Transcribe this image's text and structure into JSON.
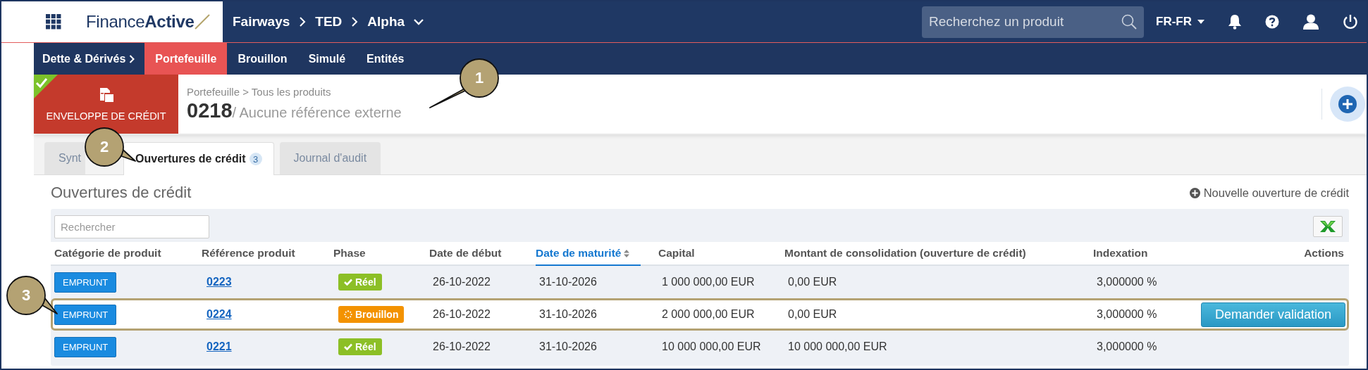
{
  "top_bar": {
    "logo": "Finance**Active**",
    "context": [
      {
        "label": "Fairways"
      },
      {
        "label": "TED"
      },
      {
        "label": "Alpha"
      }
    ],
    "search": {
      "placeholder": "Recherchez un produit"
    },
    "language": "FR-FR"
  },
  "sub_nav": {
    "section": "Dette & Dérivés",
    "items": [
      {
        "label": "Portefeuille",
        "selected": true
      },
      {
        "label": "Brouillon",
        "selected": false
      },
      {
        "label": "Simulé",
        "selected": false
      },
      {
        "label": "Entités",
        "selected": false
      }
    ]
  },
  "header": {
    "badge": "ENVELOPPE DE CRÉDIT",
    "validated": true,
    "breadcrumb": "Portefeuille > Tous les produits",
    "number": "0218",
    "external_ref": "/ Aucune référence externe"
  },
  "tabs": [
    {
      "label": "Synt",
      "selected": false
    },
    {
      "label": "Ouvertures de crédit",
      "count": "3",
      "selected": true
    },
    {
      "label": "Journal d'audit",
      "selected": false
    }
  ],
  "section": {
    "title": "Ouvertures de crédit",
    "new_link": "Nouvelle ouverture de crédit",
    "search": {
      "placeholder": "Rechercher"
    }
  },
  "table": {
    "columns": [
      {
        "label": "Catégorie de produit",
        "sorted": false
      },
      {
        "label": "Référence produit",
        "sorted": false
      },
      {
        "label": "Phase",
        "sorted": false
      },
      {
        "label": "Date de début",
        "sorted": false
      },
      {
        "label": "Date de maturité",
        "sorted": true
      },
      {
        "label": "Capital",
        "sorted": false
      },
      {
        "label": "Montant de consolidation (ouverture de crédit)",
        "sorted": false
      },
      {
        "label": "Indexation",
        "sorted": false
      },
      {
        "label": "Actions",
        "sorted": false
      }
    ],
    "rows": [
      {
        "category": "EMPRUNT",
        "reference": "0223",
        "phase": {
          "kind": "reel",
          "label": "Réel"
        },
        "start": "26-10-2022",
        "maturity": "31-10-2026",
        "capital": "1 000 000,00 EUR",
        "consolidation": "0,00 EUR",
        "indexation": "3,000000 %",
        "highlighted": false
      },
      {
        "category": "EMPRUNT",
        "reference": "0224",
        "phase": {
          "kind": "brouillon",
          "label": "Brouillon"
        },
        "start": "26-10-2022",
        "maturity": "31-10-2026",
        "capital": "2 000 000,00 EUR",
        "consolidation": "0,00 EUR",
        "indexation": "3,000000 %",
        "action": "Demander validation",
        "highlighted": true
      },
      {
        "category": "EMPRUNT",
        "reference": "0221",
        "phase": {
          "kind": "reel",
          "label": "Réel"
        },
        "start": "26-10-2022",
        "maturity": "31-10-2026",
        "capital": "10 000 000,00 EUR",
        "consolidation": "10 000 000,00 EUR",
        "indexation": "3,000000 %",
        "highlighted": false
      }
    ]
  },
  "callouts": [
    {
      "label": "1"
    },
    {
      "label": "2"
    },
    {
      "label": "3"
    }
  ]
}
